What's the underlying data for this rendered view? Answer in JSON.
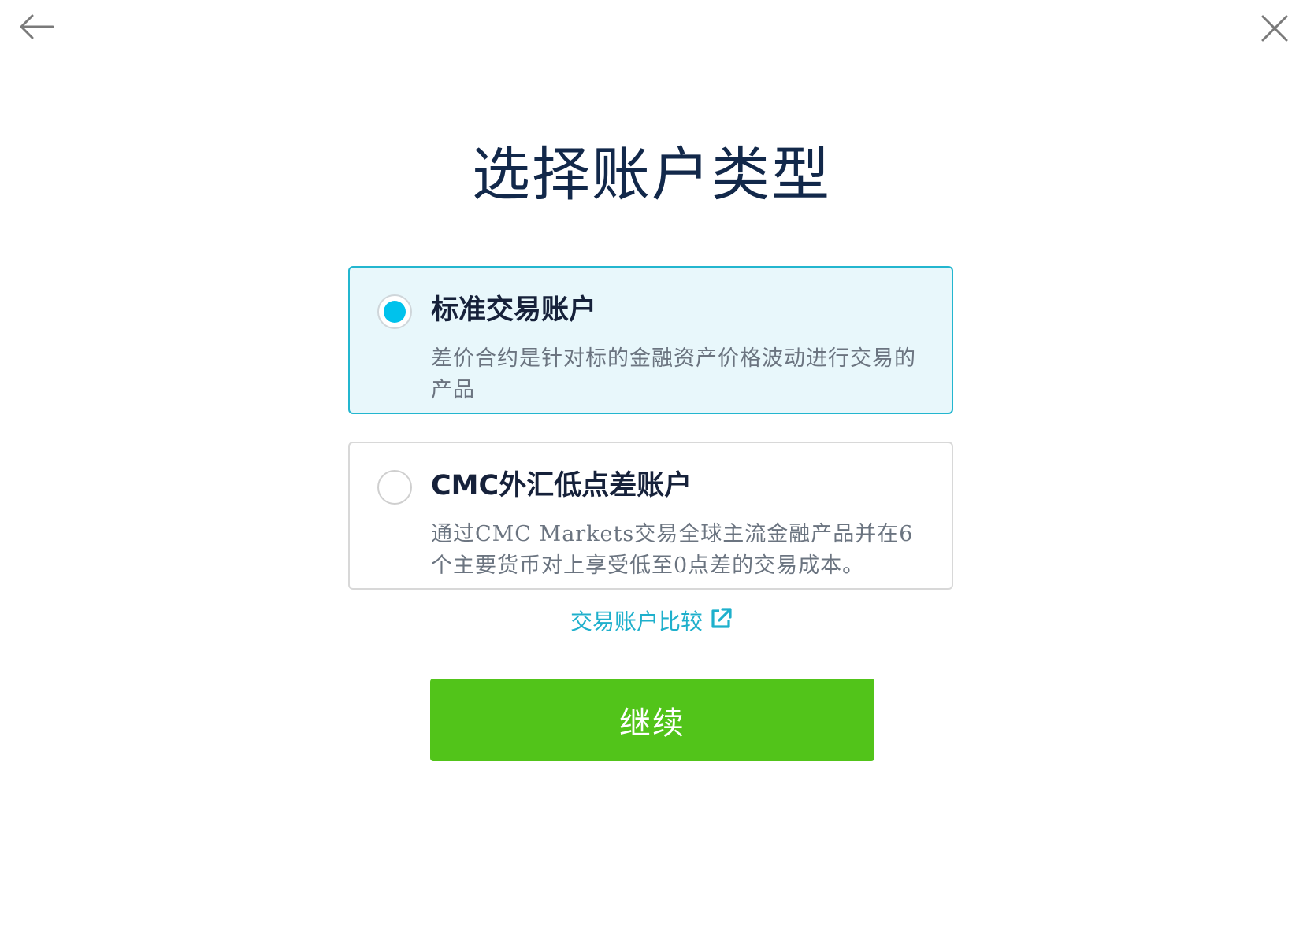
{
  "nav": {
    "back_icon": "arrow-left-icon",
    "close_icon": "close-icon"
  },
  "page": {
    "title": "选择账户类型"
  },
  "options": [
    {
      "title": "标准交易账户",
      "description": "差价合约是针对标的金融资产价格波动进行交易的产品",
      "selected": true
    },
    {
      "title": "CMC外汇低点差账户",
      "description": "通过CMC Markets交易全球主流金融产品并在6个主要货币对上享受低至0点差的交易成本。",
      "selected": false
    }
  ],
  "compare_link": {
    "label": "交易账户比较",
    "icon": "external-link-icon"
  },
  "continue_button": {
    "label": "继续"
  },
  "colors": {
    "accent": "#1fb0cc",
    "radio_selected": "#00c2ec",
    "selected_bg": "#e8f7fb",
    "primary_button": "#52c41a",
    "title": "#12284a"
  }
}
